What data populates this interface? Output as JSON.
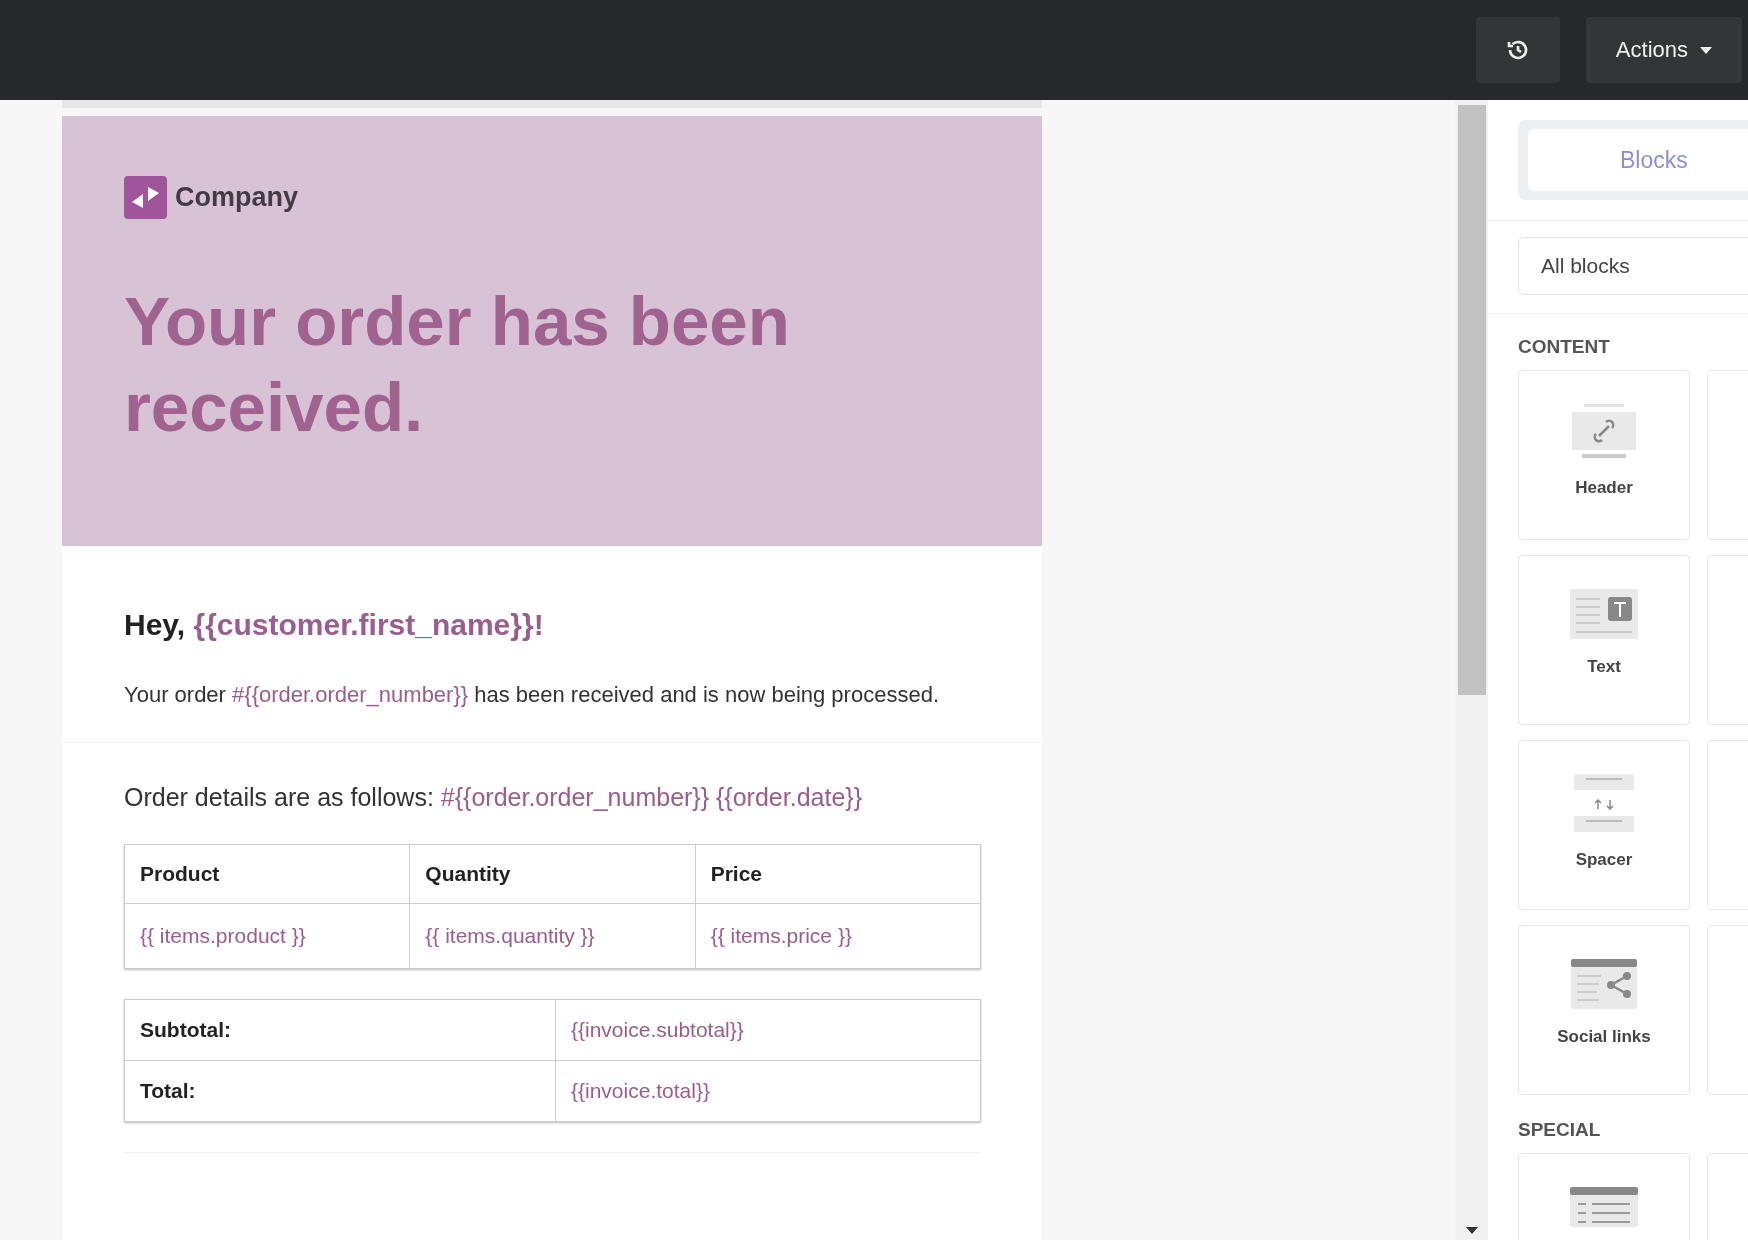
{
  "toolbar": {
    "actions_button": {
      "label": "Actions"
    }
  },
  "email": {
    "brand": {
      "name": "Company"
    },
    "headline": "Your order has been received.",
    "greeting": [
      {
        "kind": "plain",
        "text": "Hey, "
      },
      {
        "kind": "variable",
        "text": "{{customer.first_name}}!"
      }
    ],
    "intro": [
      {
        "kind": "plain",
        "text": "Your order "
      },
      {
        "kind": "variable",
        "text": "#{{order.order_number}}"
      },
      {
        "kind": "plain",
        "text": " has been received and is now being processed."
      }
    ],
    "details": [
      {
        "kind": "plain",
        "text": "Order details are as follows: "
      },
      {
        "kind": "variable",
        "text": "#{{order.order_number}} {{order.date}}"
      }
    ],
    "items_table": {
      "columns": [
        "Product",
        "Quantity",
        "Price"
      ],
      "rows": [
        [
          "{{ items.product }}",
          "{{ items.quantity }}",
          "{{ items.price }}"
        ]
      ]
    },
    "totals_table": {
      "rows": [
        {
          "label": "Subtotal:",
          "value": "{{invoice.subtotal}}"
        },
        {
          "label": "Total:",
          "value": "{{invoice.total}}"
        }
      ]
    }
  },
  "sidebar": {
    "tab": {
      "label": "Blocks",
      "selected": true
    },
    "filter": {
      "value": "All blocks"
    },
    "sections": [
      {
        "title": "CONTENT",
        "blocks": [
          {
            "kind": "header",
            "label": "Header"
          },
          {
            "kind": "cut_off"
          },
          {
            "kind": "text",
            "label": "Text"
          },
          {
            "kind": "cut_off"
          },
          {
            "kind": "spacer",
            "label": "Spacer"
          },
          {
            "kind": "cut_off"
          },
          {
            "kind": "social",
            "label": "Social links"
          },
          {
            "kind": "cut_off"
          }
        ]
      },
      {
        "title": "SPECIAL",
        "blocks": [
          {
            "kind": "list"
          },
          {
            "kind": "cut_off"
          }
        ]
      }
    ]
  }
}
